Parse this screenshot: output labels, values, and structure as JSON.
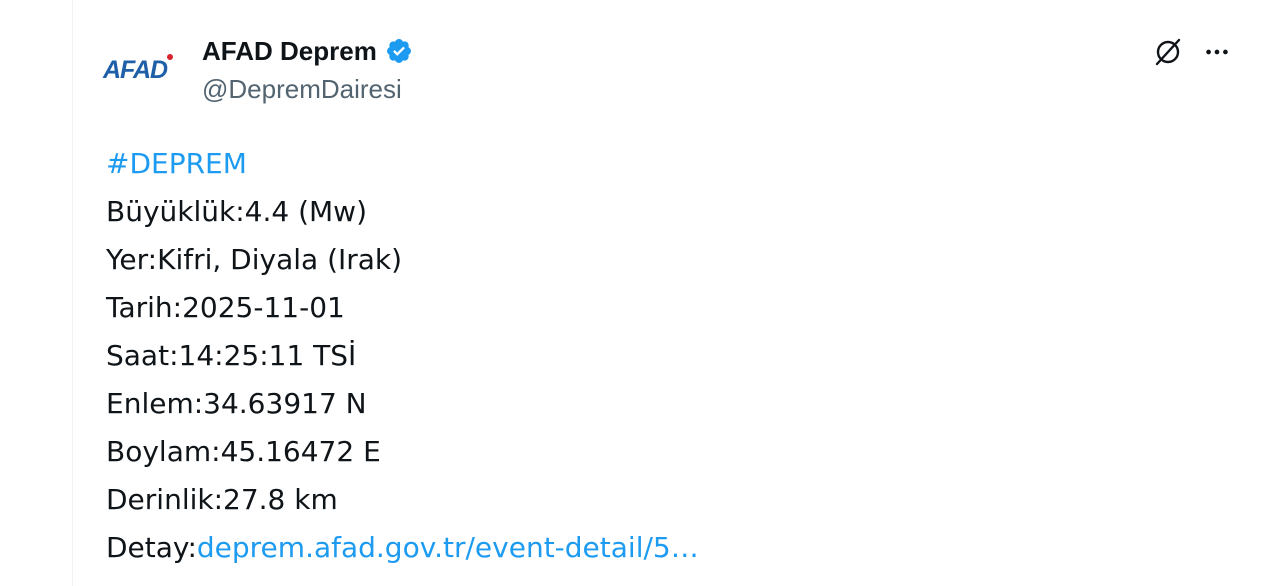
{
  "author": {
    "display_name": "AFAD Deprem",
    "handle": "@DepremDairesi",
    "logo_text": "AFAD",
    "verified_icon": "verified-badge-icon",
    "verified_color": "#1d9bf0"
  },
  "actions": {
    "grok_icon": "grok-icon",
    "more_icon": "more-horizontal-icon"
  },
  "tweet": {
    "hashtag": "#DEPREM",
    "lines": [
      {
        "label": "Büyüklük:",
        "value": "4.4 (Mw)"
      },
      {
        "label": "Yer:",
        "value": "Kifri, Diyala (Irak)"
      },
      {
        "label": "Tarih:",
        "value": "2025-11-01"
      },
      {
        "label": "Saat:",
        "value": "14:25:11 TSİ"
      },
      {
        "label": "Enlem:",
        "value": "34.63917 N"
      },
      {
        "label": "Boylam:",
        "value": "45.16472 E"
      },
      {
        "label": "Derinlik:",
        "value": "27.8 km"
      }
    ],
    "detail_label": "Detay:",
    "detail_link": "deprem.afad.gov.tr/event-detail/5…"
  },
  "colors": {
    "link": "#1d9bf0",
    "text": "#0f1419",
    "secondary": "#536471",
    "logo_blue": "#1f5fa8",
    "logo_red": "#d9232d"
  }
}
